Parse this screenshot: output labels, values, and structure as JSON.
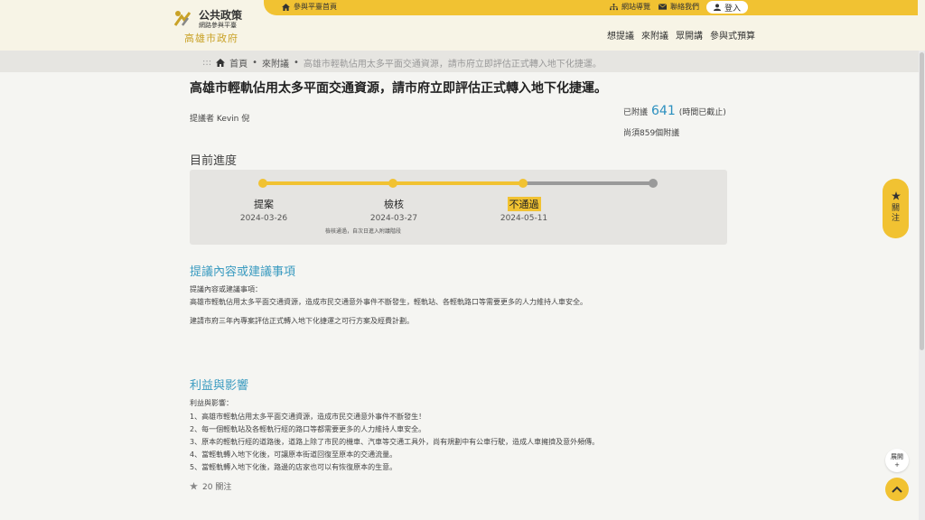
{
  "topbar": {
    "home_link": "參與平臺首頁",
    "sitemap": "網站導覽",
    "contact": "聯絡我們",
    "login": "登入"
  },
  "logo": {
    "line1": "公共政策",
    "line2": "網路參與平臺",
    "line3": "高雄市政府"
  },
  "mainnav": [
    "想提議",
    "來附議",
    "眾開講",
    "參與式預算"
  ],
  "breadcrumb": {
    "sep": ":::",
    "home": "首頁",
    "section": "來附議",
    "current": "高雄市輕軌佔用太多平面交通資源，請市府立即評估正式轉入地下化捷運。"
  },
  "proposal": {
    "title": "高雄市輕軌佔用太多平面交通資源，請市府立即評估正式轉入地下化捷運。",
    "proposer": "提議者 Kevin 倪",
    "seconded_prefix": "已附議",
    "seconded_count": "641",
    "seconded_suffix": "(時間已截止)",
    "remaining": "尚須859個附議"
  },
  "progress": {
    "heading": "目前進度",
    "done_fraction": 0.67,
    "stages": [
      {
        "label": "提案",
        "date": "2024-03-26"
      },
      {
        "label": "檢核",
        "date": "2024-03-27"
      },
      {
        "label": "不通過",
        "date": "2024-05-11"
      }
    ],
    "note": "檢核通過，自次日進入附議階段"
  },
  "side": {
    "follow_label": "關注"
  },
  "content": {
    "heading": "提議內容或建議事項",
    "lines": [
      "提議內容或建議事項：",
      "高雄市輕軌佔用太多平面交通資源，造成市民交通意外事件不斷發生，輕軌站、各輕軌路口等需要更多的人力維持人車安全。",
      "",
      "建請市府三年內專案評估正式轉入地下化捷運之可行方案及經費計劃。"
    ]
  },
  "benefits": {
    "heading": "利益與影響",
    "lines": [
      "利益與影響：",
      "1、高雄市輕軌佔用太多平面交通資源，造成市民交通意外事件不斷發生！",
      "2、每一個輕軌站及各輕軌行經的路口等都需要更多的人力維持人車安全。",
      "3、原本的輕軌行經的道路後，道路上除了市民的機車、汽車等交通工具外，尚有規劃中有公車行駛，造成人車擁擠及意外頻傳。",
      "4、當輕軌轉入地下化後，可讓原本街道回復至原本的交通流量。",
      "5、當輕軌轉入地下化後，路邊的店家也可以有恢復原本的生意。"
    ]
  },
  "followers": "20 關注",
  "floating": {
    "expand": "展開"
  },
  "colors": {
    "accent": "#f1c232",
    "link": "#3a9bc0",
    "count": "#2a8fbf"
  }
}
